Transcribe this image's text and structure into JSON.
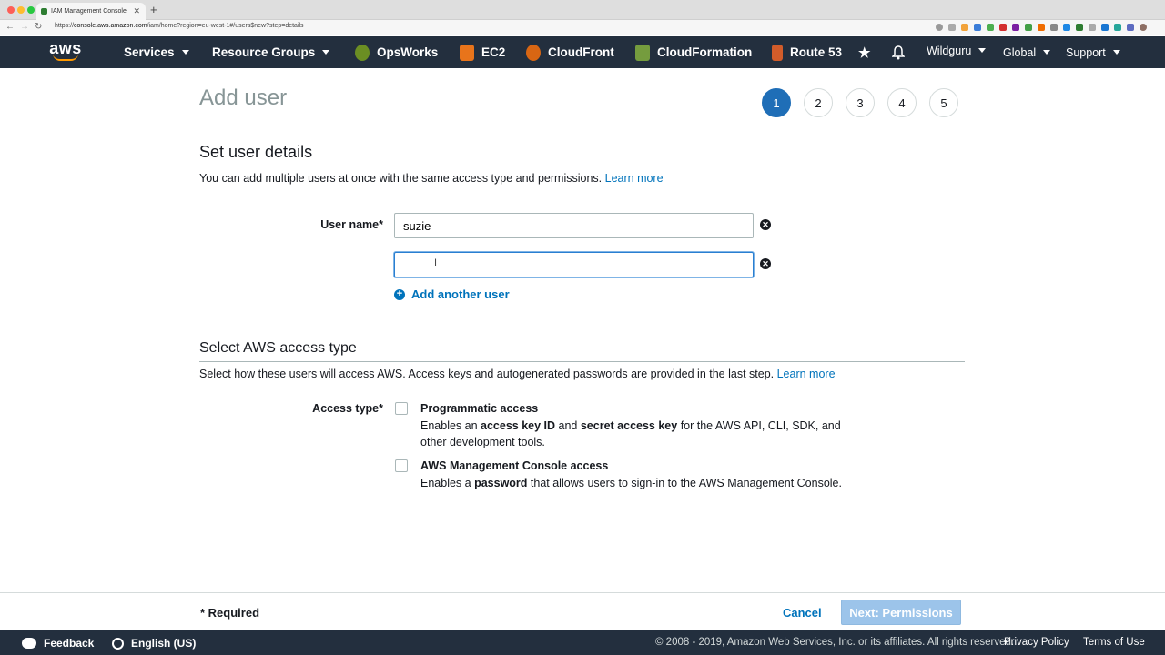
{
  "browser": {
    "tab_title": "IAM Management Console",
    "url_prefix": "https://",
    "url_host": "console.aws.amazon.com",
    "url_path": "/iam/home?region=eu-west-1#/users$new?step=details"
  },
  "nav": {
    "logo": "aws",
    "services": "Services",
    "resource_groups": "Resource Groups",
    "opsworks": "OpsWorks",
    "ec2": "EC2",
    "cloudfront": "CloudFront",
    "cloudformation": "CloudFormation",
    "route53": "Route 53",
    "account": "Wildguru",
    "region": "Global",
    "support": "Support"
  },
  "page": {
    "title": "Add user",
    "steps": [
      "1",
      "2",
      "3",
      "4",
      "5"
    ],
    "active_step": 1
  },
  "user_details": {
    "section_title": "Set user details",
    "description": "You can add multiple users at once with the same access type and permissions.",
    "learn_more": "Learn more",
    "user_name_label": "User name*",
    "user_names": [
      "suzie",
      ""
    ],
    "add_another_user": "Add another user"
  },
  "access_type": {
    "section_title": "Select AWS access type",
    "description": "Select how these users will access AWS. Access keys and autogenerated passwords are provided in the last step.",
    "learn_more": "Learn more",
    "label": "Access type*",
    "programmatic": {
      "title": "Programmatic access",
      "desc_1": "Enables an ",
      "bold_1": "access key ID",
      "desc_2": " and ",
      "bold_2": "secret access key",
      "desc_3": " for the AWS API, CLI, SDK, and other development tools.",
      "checked": false
    },
    "console": {
      "title": "AWS Management Console access",
      "desc_1": "Enables a ",
      "bold_1": "password",
      "desc_2": " that allows users to sign-in to the AWS Management Console.",
      "checked": false
    }
  },
  "actions": {
    "required_note": "* Required",
    "cancel": "Cancel",
    "next": "Next: Permissions"
  },
  "footer": {
    "feedback": "Feedback",
    "language": "English (US)",
    "copyright": "© 2008 - 2019, Amazon Web Services, Inc. or its affiliates. All rights reserved.",
    "privacy": "Privacy Policy",
    "terms": "Terms of Use"
  },
  "colors": {
    "nav_bg": "#232f3e",
    "link": "#0073bb",
    "active_step": "#1f6eb7",
    "primary_disabled": "#9cc4ea",
    "aws_orange": "#ff9900"
  }
}
